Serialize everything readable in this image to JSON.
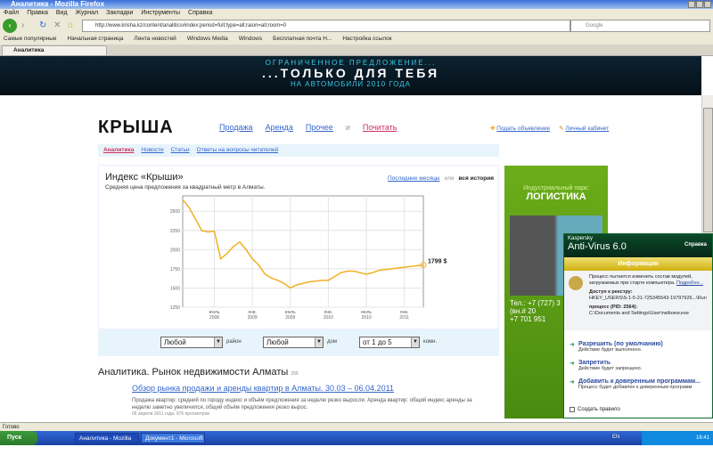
{
  "window": {
    "title": "Аналитика - Mozilla Firefox"
  },
  "menu": [
    "Файл",
    "Правка",
    "Вид",
    "Журнал",
    "Закладки",
    "Инструменты",
    "Справка"
  ],
  "nav": {
    "url": "http://www.krisha.kz/content/analitics#index:period=full;type=all;raion=all;room=0",
    "search_placeholder": "Google"
  },
  "bookmarks": [
    "Самые популярные",
    "Начальная страница",
    "Лента новостей",
    "Windows Media",
    "Windows",
    "Бесплатная почта H...",
    "Настройка ссылок"
  ],
  "tab": {
    "label": "Аналитика"
  },
  "banner": {
    "line1": "ОГРАНИЧЕННОЕ ПРЕДЛОЖЕНИЕ...",
    "line2": "...ТОЛЬКО ДЛЯ ТЕБЯ",
    "line3": "НА АВТОМОБИЛИ 2010 ГОДА"
  },
  "site": {
    "logo": "КРЫША",
    "nav": [
      "Продажа",
      "Аренда",
      "Прочее",
      "и",
      "Почитать"
    ],
    "right_links": [
      "Подать объявление",
      "Личный кабинет"
    ],
    "subnav": [
      "Аналитика",
      "Новости",
      "Статьи",
      "Ответы на вопросы читателей"
    ]
  },
  "index": {
    "title": "Индекс «Крыши»",
    "subtitle": "Средняя цена предложения за квадратный метр в Алматы.",
    "period_recent": "Последние месяцы",
    "period_or": "или",
    "period_all": "вся история"
  },
  "chart_data": {
    "type": "line",
    "title": "Индекс «Крыши»",
    "ylabel": "",
    "xlabel": "",
    "ylim": [
      1250,
      2700
    ],
    "yticks": [
      1250,
      1500,
      1750,
      2000,
      2250,
      2500
    ],
    "xticks": [
      {
        "m": 5,
        "label": "июль",
        "year": "2008"
      },
      {
        "m": 11,
        "label": "янв.",
        "year": "2009"
      },
      {
        "m": 17,
        "label": "июль",
        "year": "2009"
      },
      {
        "m": 23,
        "label": "янв.",
        "year": "2010"
      },
      {
        "m": 29,
        "label": "июль",
        "year": "2010"
      },
      {
        "m": 35,
        "label": "янв.",
        "year": "2011"
      }
    ],
    "series": [
      {
        "name": "Индекс",
        "color": "#f0b020",
        "values": [
          2650,
          2550,
          2400,
          2250,
          2230,
          2240,
          1880,
          1950,
          2040,
          2100,
          2000,
          1880,
          1800,
          1680,
          1630,
          1600,
          1560,
          1500,
          1540,
          1560,
          1580,
          1590,
          1600,
          1600,
          1650,
          1700,
          1720,
          1720,
          1700,
          1680,
          1700,
          1730,
          1740,
          1750,
          1760,
          1770,
          1780,
          1790,
          1799
        ]
      }
    ],
    "last_label": "1799 $"
  },
  "filters": [
    {
      "value": "Любой",
      "label": "район"
    },
    {
      "value": "Любой",
      "label": "дом"
    },
    {
      "value": "от 1 до 5",
      "label": "комн."
    }
  ],
  "section": {
    "title": "Аналитика. Рынок недвижимости Алматы",
    "count": "205"
  },
  "article": {
    "title": "Обзор рынка продажи и аренды квартир в Алматы. 30.03 – 06.04.2011",
    "text": "Продажа квартир: средний по городу индекс и объём предложения за неделю резко выросли. Аренда квартир: общий индекс аренды за неделю заметно увеличился, общий объём предложения резко вырос.",
    "meta": "06 апреля 2011 года, 976 просмотров"
  },
  "ad": {
    "line1": "Индустриальный парк:",
    "line2": "ЛОГИСТИКА",
    "phone1": "Тел.: +7 (727) 3",
    "phone2": "(вн.# 20",
    "phone3": "+7 701 951"
  },
  "kaspersky": {
    "brand": "Kaspersky",
    "product": "Anti-Virus 6.0",
    "help": "Справка",
    "header": "Информация",
    "message": "Процесс пытается изменить состав модулей, загружаемых при старте компьютера.",
    "more": "Подробно...",
    "registry_label": "Доступ к реестру:",
    "registry_value": "HKEY_USERS\\S-1-5-21-725345543-19797926...\\Run",
    "process_label": "процесс (PID: 2564):",
    "process_value": "C:\\Documents and Settings\\User\\rwiboew.exe",
    "actions": [
      {
        "title": "Разрешить (по умолчанию)",
        "desc": "Действие будет выполнено."
      },
      {
        "title": "Запретить",
        "desc": "Действие будет запрещено."
      },
      {
        "title": "Добавить к доверенным программам...",
        "desc": "Процесс будет добавлен к доверенным программ"
      }
    ],
    "checkbox": "Создать правило"
  },
  "status": "Готово",
  "taskbar": {
    "start": "Пуск",
    "items": [
      "Аналитика - Mozilla F...",
      "Документ1 - Microsoft ..."
    ],
    "lang": "EN",
    "clock": "16:41"
  }
}
